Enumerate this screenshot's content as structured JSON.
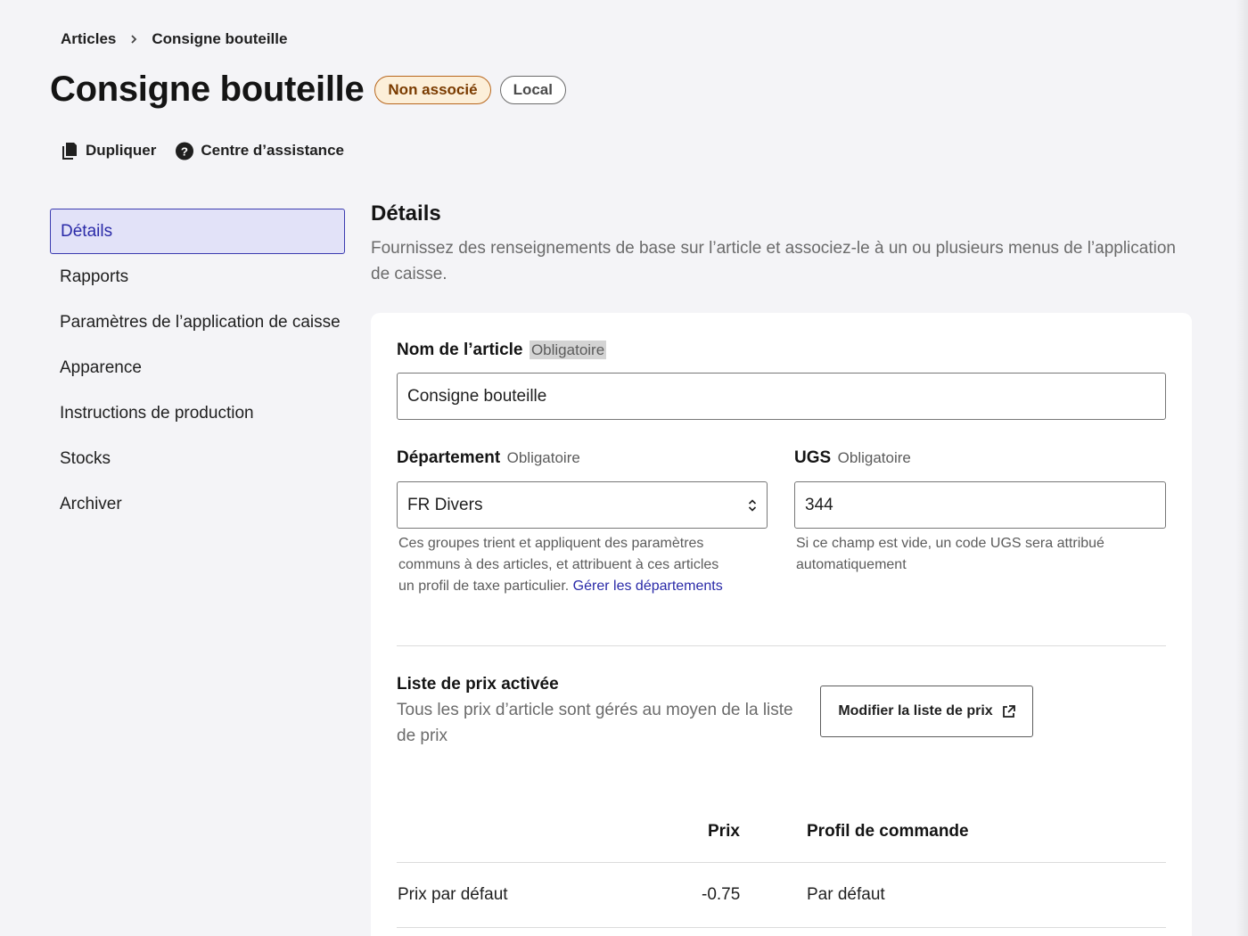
{
  "breadcrumb": {
    "parent": "Articles",
    "current": "Consigne bouteille"
  },
  "header": {
    "title": "Consigne bouteille",
    "badge_status": "Non associé",
    "badge_scope": "Local"
  },
  "actions": {
    "duplicate": "Dupliquer",
    "help_center": "Centre d’assistance"
  },
  "sidebar": {
    "items": [
      {
        "label": "Détails",
        "active": true
      },
      {
        "label": "Rapports"
      },
      {
        "label": "Paramètres de l’application de caisse"
      },
      {
        "label": "Apparence"
      },
      {
        "label": "Instructions de production"
      },
      {
        "label": "Stocks"
      },
      {
        "label": "Archiver"
      }
    ]
  },
  "section": {
    "title": "Détails",
    "description": "Fournissez des renseignements de base sur l’article et associez-le à un ou plusieurs menus de l’application de caisse."
  },
  "form": {
    "name": {
      "label": "Nom de l’article",
      "required": "Obligatoire",
      "value": "Consigne bouteille"
    },
    "department": {
      "label": "Département",
      "required": "Obligatoire",
      "value": "FR Divers",
      "help": "Ces groupes trient et appliquent des paramètres communs à des articles, et attribuent à ces articles un profil de taxe particulier.",
      "help_link": "Gérer les départements"
    },
    "sku": {
      "label": "UGS",
      "required": "Obligatoire",
      "value": "344",
      "help": "Si ce champ est vide, un code UGS sera attribué automatiquement"
    }
  },
  "price_list": {
    "title": "Liste de prix activée",
    "description": "Tous les prix d’article sont gérés au moyen de la liste de prix",
    "button": "Modifier la liste de prix"
  },
  "price_table": {
    "headers": {
      "price": "Prix",
      "order_profile": "Profil de commande"
    },
    "rows": [
      {
        "name": "Prix par défaut",
        "price": "-0.75",
        "order_profile": "Par défaut"
      }
    ]
  },
  "colors": {
    "accent": "#2a2aa8",
    "active_bg": "#e2e2f8",
    "warn_bg": "#fcefd9",
    "warn_border": "#b8671d"
  }
}
